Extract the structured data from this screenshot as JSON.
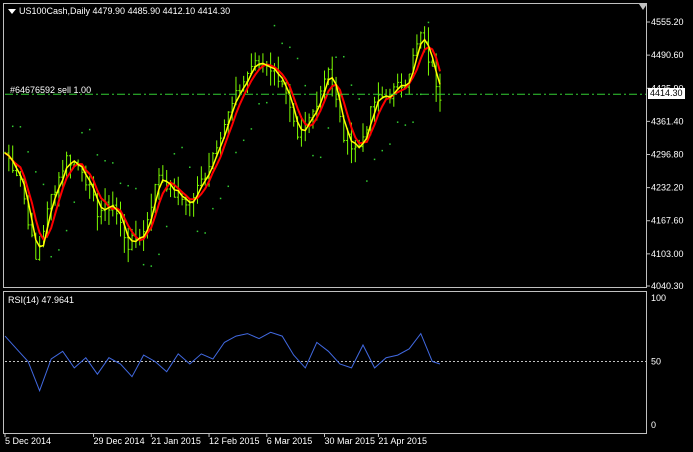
{
  "header": {
    "symbol_line": "US100Cash,Daily  4479.90 4485.90 4412.10 4414.30"
  },
  "order": {
    "label": "#64676592 sell 1.00",
    "line_color": "#32cd32"
  },
  "current_price": "4414.30",
  "rsi": {
    "label": "RSI(14) 47.9641",
    "color": "#4169e1",
    "ticks": [
      "100",
      "50",
      "0"
    ],
    "level": 50
  },
  "colors": {
    "background": "#000000",
    "frame": "#c0c0c0",
    "bars": "#7cfc00",
    "ma_fast": "#ffff00",
    "ma_slow": "#ff0000",
    "sar": "#32cd32",
    "rsi": "#4169e1"
  },
  "chart_data": [
    {
      "type": "line",
      "title": "US100Cash,Daily",
      "series_kinds": [
        "OHLC bars",
        "moving average (yellow)",
        "moving average (red)",
        "parabolic SAR (dots)"
      ],
      "ylim": [
        4040.3,
        4555.2
      ],
      "y_ticks": [
        4555.2,
        4490.6,
        4425.9,
        4361.4,
        4296.8,
        4232.2,
        4167.6,
        4103.0,
        4040.3
      ],
      "x_ticks": [
        "5 Dec 2014",
        "29 Dec 2014",
        "21 Jan 2015",
        "12 Feb 2015",
        "6 Mar 2015",
        "30 Mar 2015",
        "21 Apr 2015"
      ],
      "x": [
        0,
        4,
        8,
        12,
        16,
        20,
        24,
        28,
        32,
        36,
        40,
        44,
        48,
        52,
        56,
        60,
        64,
        68,
        72,
        76,
        80,
        84,
        88,
        92,
        96,
        100,
        104,
        108,
        113
      ],
      "close": [
        4300,
        4250,
        4090,
        4215,
        4290,
        4270,
        4185,
        4200,
        4120,
        4145,
        4260,
        4220,
        4200,
        4260,
        4340,
        4410,
        4470,
        4475,
        4440,
        4320,
        4380,
        4470,
        4330,
        4310,
        4400,
        4415,
        4440,
        4530,
        4414.3
      ],
      "grid": false
    },
    {
      "type": "line",
      "title": "RSI(14) 47.9641",
      "ylim": [
        0,
        100
      ],
      "y_ticks": [
        100,
        50,
        0
      ],
      "level": 50,
      "x": [
        0,
        3,
        6,
        9,
        12,
        15,
        18,
        21,
        24,
        27,
        30,
        33,
        36,
        39,
        42,
        45,
        48,
        51,
        54,
        57,
        60,
        63,
        66,
        69,
        72,
        75,
        78,
        81,
        84,
        87,
        90,
        93,
        96,
        99,
        102,
        105,
        108,
        111,
        113
      ],
      "values": [
        70,
        60,
        50,
        27,
        52,
        58,
        45,
        53,
        40,
        53,
        48,
        38,
        55,
        50,
        42,
        56,
        48,
        56,
        52,
        65,
        70,
        72,
        68,
        73,
        70,
        55,
        45,
        65,
        58,
        48,
        45,
        63,
        45,
        53,
        55,
        60,
        72,
        50,
        48
      ],
      "grid": false
    }
  ]
}
